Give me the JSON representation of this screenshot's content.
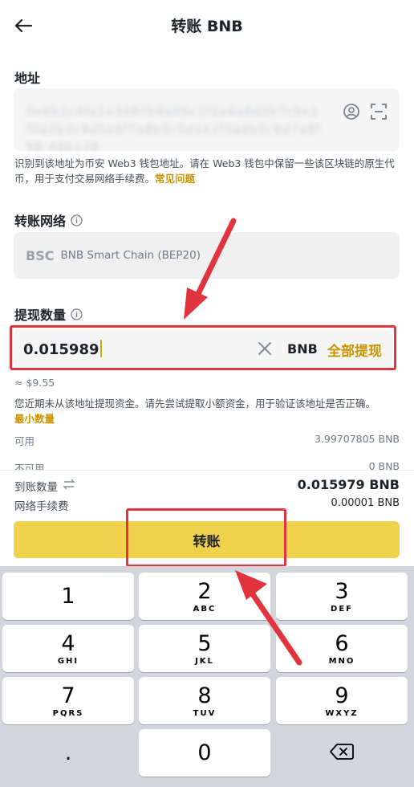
{
  "header": {
    "title": "转账 BNB"
  },
  "address": {
    "label": "地址",
    "value_blurred": "0x6b2c4fa1e3d87b9a05c1f2e4a8d3b7c9e1f0a2b3c4d5e6f7a8b9c0d1e2f3a4b5c6d7e8f9B 48b128",
    "hint": "识别到该地址为币安 Web3 钱包地址。请在 Web3 钱包中保留一些该区块链的原生代币，用于支付交易网络手续费。",
    "hint_link": "常见问题"
  },
  "network": {
    "label": "转账网络",
    "code": "BSC",
    "name": "BNB Smart Chain (BEP20)"
  },
  "amount": {
    "label": "提现数量",
    "value": "0.015989",
    "unit": "BNB",
    "max_label": "全部提现",
    "fiat_estimate": "≈ $9.55",
    "note": "您近期未从该地址提现资金。请先尝试提取小额资金，用于验证该地址是否正确。",
    "note_link": "最小数量",
    "available_label": "可用",
    "available_value": "3.99707805 BNB",
    "unavailable_label": "不可用",
    "unavailable_value": "0 BNB"
  },
  "summary": {
    "received_label": "到账数量",
    "received_value": "0.015979 BNB",
    "fee_label": "网络手续费",
    "fee_value": "0.00001 BNB"
  },
  "submit": {
    "label": "转账"
  },
  "keypad": {
    "keys": [
      {
        "num": "1",
        "letters": ""
      },
      {
        "num": "2",
        "letters": "ABC"
      },
      {
        "num": "3",
        "letters": "DEF"
      },
      {
        "num": "4",
        "letters": "GHI"
      },
      {
        "num": "5",
        "letters": "JKL"
      },
      {
        "num": "6",
        "letters": "MNO"
      },
      {
        "num": "7",
        "letters": "PQRS"
      },
      {
        "num": "8",
        "letters": "TUV"
      },
      {
        "num": "9",
        "letters": "WXYZ"
      },
      {
        "num": ".",
        "letters": ""
      },
      {
        "num": "0",
        "letters": ""
      }
    ]
  },
  "colors": {
    "accent": "#c99400",
    "button": "#f0d14b",
    "annotation": "#e2343e"
  }
}
